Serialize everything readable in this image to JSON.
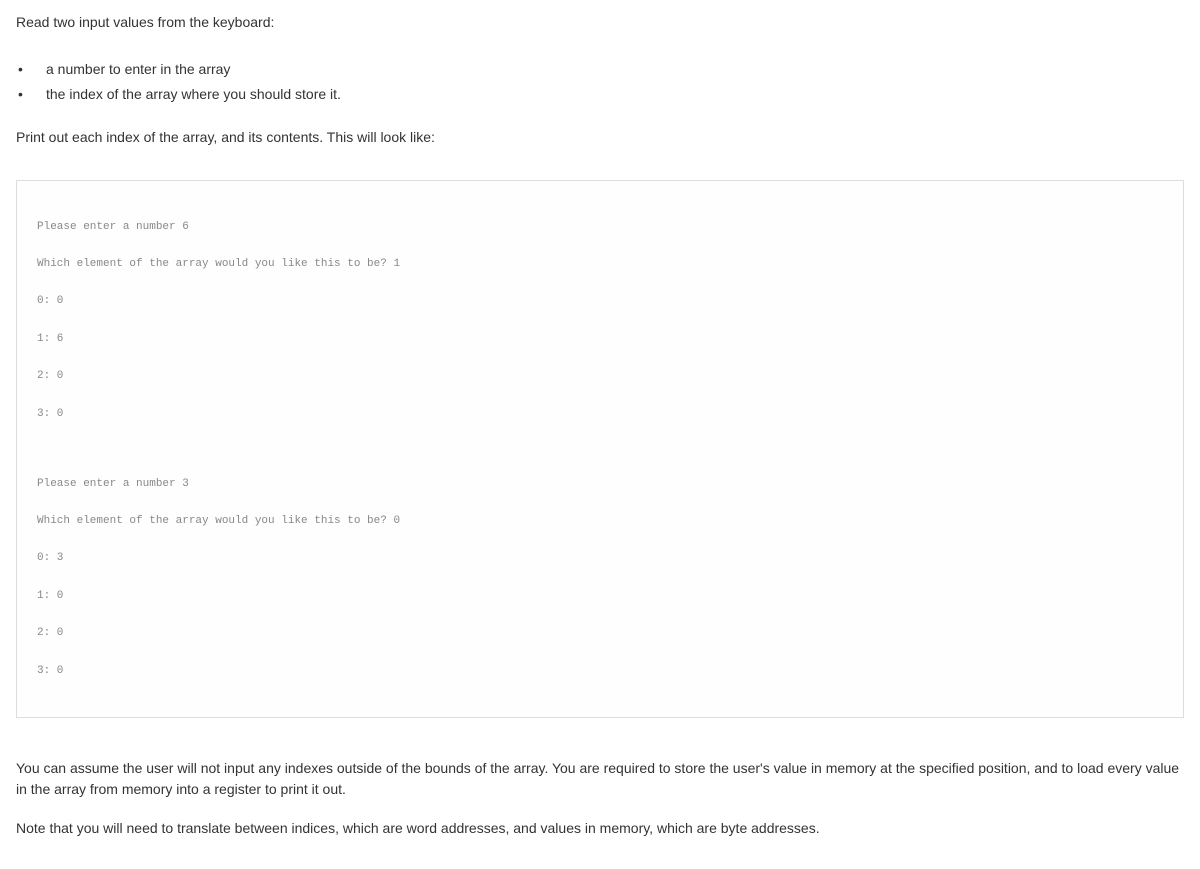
{
  "intro": "Read two input values from the keyboard:",
  "bullets": [
    "a number to enter in the array",
    "the index of the array where you should store it."
  ],
  "preCodeText": "Print out each index of the array, and its contents. This will look like:",
  "code": {
    "block1": [
      "Please enter a number 6",
      "Which element of the array would you like this to be? 1",
      "0: 0",
      "1: 6",
      "2: 0",
      "3: 0"
    ],
    "block2": [
      "Please enter a number 3",
      "Which element of the array would you like this to be? 0",
      "0: 3",
      "1: 0",
      "2: 0",
      "3: 0"
    ]
  },
  "postParagraph1": "You can assume the user will not input any indexes outside of the bounds of the array. You are required to store the user's value in memory at the specified position, and to load every value in the array from memory into a register to print it out.",
  "postParagraph2": "Note that you will need to translate between indices, which are word addresses, and values in memory, which are byte addresses."
}
